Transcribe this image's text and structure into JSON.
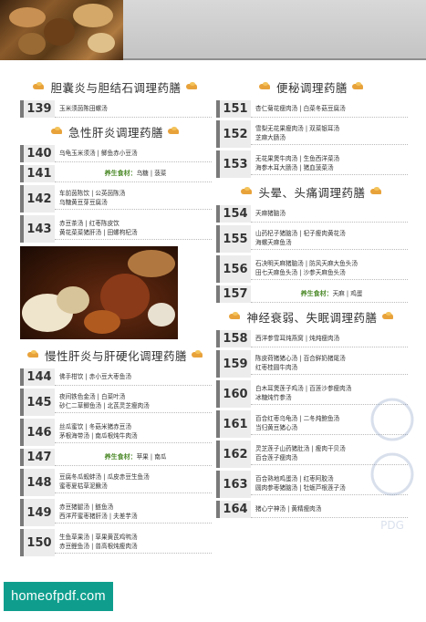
{
  "sections_left": [
    {
      "title": "胆囊炎与胆结石调理药膳",
      "rows": [
        {
          "num": "139",
          "lines": [
            "玉米须茵陈田螺汤"
          ]
        }
      ]
    },
    {
      "title": "急性肝炎调理药膳",
      "rows": [
        {
          "num": "140",
          "lines": [
            "乌龟玉米须汤 | 鲫鱼赤小豆汤"
          ]
        },
        {
          "num": "141",
          "special": true,
          "label": "养生食材：",
          "foods": "乌糖 | 菠菜"
        },
        {
          "num": "142",
          "lines": [
            "车前茵陈饮 | 公英茵陈汤",
            "乌糖黄豆芽豆腐汤"
          ]
        },
        {
          "num": "143",
          "lines": [
            "赤豆茶汤 | 红枣陈皮饮",
            "黄花菜菜猪肝汤 | 田螺枸杞汤"
          ]
        }
      ]
    },
    {
      "title": "慢性肝炎与肝硬化调理药膳",
      "rows": [
        {
          "num": "144",
          "lines": [
            "佛手柑饮 | 赤小豆大枣鱼汤"
          ]
        },
        {
          "num": "145",
          "lines": [
            "夜间铁色金汤 | 白菜叶汤",
            "砂仁二草鲫鱼汤 | 北芪灵芝瘦肉汤"
          ]
        },
        {
          "num": "146",
          "lines": [
            "丝瓜蜜饮 | 冬菇米猪赤豆汤",
            "茅根海带汤 | 南瓜根炖牛肉汤"
          ]
        },
        {
          "num": "147",
          "special": true,
          "label": "养生食材：",
          "foods": "苹果 | 南瓜"
        },
        {
          "num": "148",
          "lines": [
            "豆腐冬瓜蚬蚌汤 | 瓜皮赤豆生鱼汤",
            "蜜枣夏枯草泥鳅汤"
          ]
        },
        {
          "num": "149",
          "lines": [
            "赤豆猪腿汤 | 鲢鱼汤",
            "西洋芹蜜枣猪肝汤 | 夫差芋汤"
          ]
        },
        {
          "num": "150",
          "lines": [
            "生鱼草果汤 | 草果黄芪鸡鸭汤",
            "赤豆鲤鱼汤 | 普高根炖瘦肉汤"
          ]
        }
      ]
    }
  ],
  "sections_right": [
    {
      "title": "便秘调理药膳",
      "rows": [
        {
          "num": "151",
          "lines": [
            "杏仁菊花瘦肉汤 | 白菜冬菇豆腐汤"
          ]
        },
        {
          "num": "152",
          "lines": [
            "雪梨无花果瘦肉汤 | 双菜银耳汤",
            "芝麻大肠汤"
          ]
        },
        {
          "num": "153",
          "lines": [
            "无花果煲牛肉汤 | 生鱼西洋菜汤",
            "海参木耳大肠汤 | 猪血菠菜汤"
          ]
        }
      ]
    },
    {
      "title": "头晕、头痛调理药膳",
      "rows": [
        {
          "num": "154",
          "lines": [
            "天麻猪脑汤"
          ]
        },
        {
          "num": "155",
          "lines": [
            "山药杞子猪脑汤 | 杞子瘦肉黄花汤",
            "海螺天麻鱼汤"
          ]
        },
        {
          "num": "156",
          "lines": [
            "石决明天麻猪脑汤 | 防风天麻大鱼头汤",
            "田七天麻鱼头汤 | 沙参天麻鱼头汤"
          ]
        },
        {
          "num": "157",
          "special": true,
          "label": "养生食材：",
          "foods": "天麻 | 鸡蛋"
        }
      ]
    },
    {
      "title": "神经衰弱、失眠调理药膳",
      "rows": [
        {
          "num": "158",
          "lines": [
            "西洋参雪耳炖燕窝 | 炖炖瘦肉汤"
          ]
        },
        {
          "num": "159",
          "lines": [
            "陈皮荷猪猪心汤 | 百合鲜奶猪尾汤",
            "红枣桂圆牛肉汤"
          ]
        },
        {
          "num": "160",
          "lines": [
            "白木耳煲莲子鸡汤 | 百莲沙参瘦肉汤",
            "冰糖炖竹参汤"
          ]
        },
        {
          "num": "161",
          "lines": [
            "百合红枣乌龟汤 | 二冬炖鲍鱼汤",
            "当归黄豆猪心汤"
          ]
        },
        {
          "num": "162",
          "lines": [
            "灵芝莲子山药猪肚汤 | 瘦肉干贝汤",
            "百合莲子瘦肉汤"
          ]
        },
        {
          "num": "163",
          "lines": [
            "百合熟地鸡蛋汤 | 红枣阿胶汤",
            "圆肉参枣猪脑汤 | 牡蛎芦根莲子汤"
          ]
        },
        {
          "num": "164",
          "lines": [
            "猪心宁神汤 | 黄精瘦肉汤"
          ]
        }
      ]
    }
  ],
  "watermark": {
    "text": "PDG"
  },
  "site_logo": {
    "text": "homeofpdf.com"
  },
  "colors": {
    "accent_orange": "#e8a23a",
    "special_green": "#4d8a2a",
    "number_bar": "#7a7a7a",
    "logo_teal": "#0f9e8e"
  }
}
